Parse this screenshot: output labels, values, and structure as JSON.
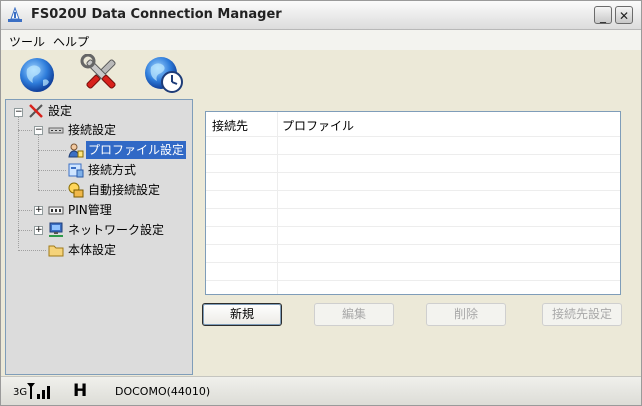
{
  "window": {
    "title": "FS020U Data Connection Manager",
    "minimize_glyph": "_",
    "close_glyph": "✕"
  },
  "menu": {
    "items": [
      "ツール",
      "ヘルプ"
    ]
  },
  "toolbar": {
    "icons": [
      "globe-connect-icon",
      "tools-icon",
      "globe-clock-icon"
    ]
  },
  "tree": {
    "root": "設定",
    "items": [
      {
        "label": "接続設定",
        "icon": "network-icon"
      },
      {
        "label": "プロファイル設定",
        "icon": "profile-user-icon",
        "selected": true
      },
      {
        "label": "接続方式",
        "icon": "connection-method-icon"
      },
      {
        "label": "自動接続設定",
        "icon": "auto-connect-icon"
      },
      {
        "label": "PIN管理",
        "icon": "pin-icon"
      },
      {
        "label": "ネットワーク設定",
        "icon": "monitor-network-icon"
      },
      {
        "label": "本体設定",
        "icon": "folder-icon"
      }
    ]
  },
  "list": {
    "columns": [
      "接続先",
      "プロファイル"
    ],
    "rows": []
  },
  "buttons": {
    "new": "新規",
    "edit": "編集",
    "delete": "削除",
    "connection_settings": "接続先設定"
  },
  "status": {
    "network_type": "3G",
    "mode": "H",
    "carrier": "DOCOMO(44010)"
  },
  "colors": {
    "selection": "#3169c6",
    "window_bg": "#ece9d8",
    "tree_bg": "#dcdcdc"
  }
}
